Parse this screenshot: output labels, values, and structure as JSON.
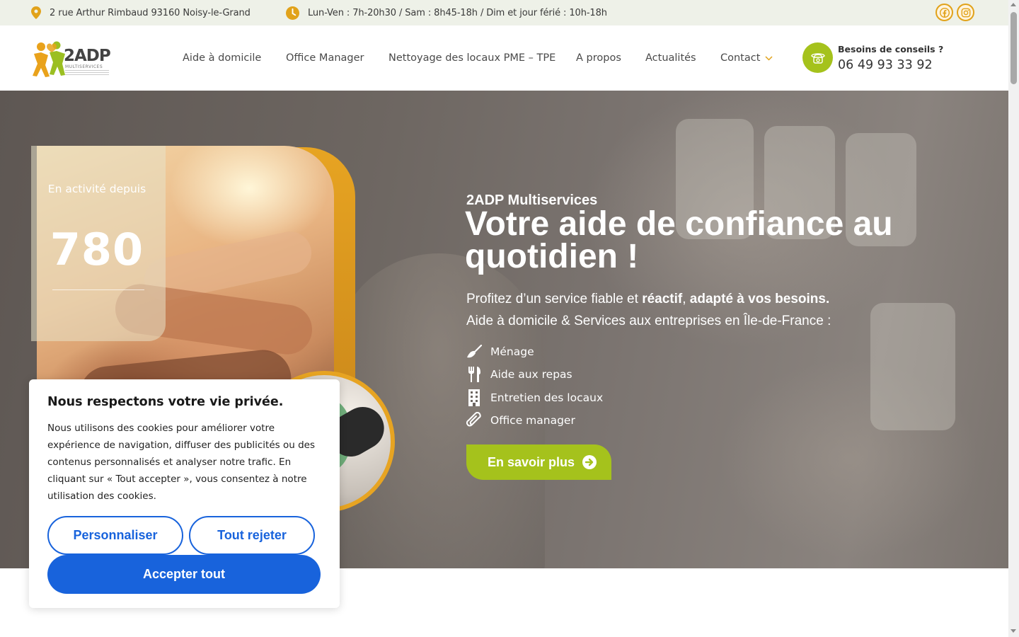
{
  "topbar": {
    "address": "2 rue Arthur Rimbaud 93160 Noisy-le-Grand",
    "address_icon": "map-pin-icon",
    "hours": "Lun-Ven : 7h-20h30 / Sam : 8h45-18h / Dim et jour férié : 10h-18h",
    "hours_icon": "clock-icon",
    "social": [
      "facebook-icon",
      "instagram-icon"
    ],
    "accent_color": "#e1a21a"
  },
  "header": {
    "logo_text": "2ADP",
    "logo_sub": "MULTISERVICES",
    "nav": [
      {
        "label": "Aide à domicile"
      },
      {
        "label": "Office Manager"
      },
      {
        "label": "Nettoyage des locaux PME – TPE"
      },
      {
        "label": "A propos"
      },
      {
        "label": "Actualités"
      },
      {
        "label": "Contact",
        "has_dropdown": true
      }
    ],
    "phone_label": "Besoins de conseils ?",
    "phone_number": "06 49 93 33 92",
    "brand_green": "#a5c21c"
  },
  "hero": {
    "stat_label": "En activité depuis",
    "stat_number": "780",
    "eyebrow": "2ADP Multiservices",
    "title": "Votre aide de confiance au quotidien !",
    "p1_start": "Profitez d’un service fiable et ",
    "p1_bold1": "réactif",
    "p1_mid": ", ",
    "p1_bold2": "adapté à vos besoins.",
    "p2": "Aide à domicile & Services aux entreprises en Île-de-France :",
    "features": [
      {
        "label": "Ménage",
        "icon": "broom-icon"
      },
      {
        "label": "Aide aux repas",
        "icon": "utensils-icon"
      },
      {
        "label": "Entretien des locaux",
        "icon": "building-icon"
      },
      {
        "label": "Office manager",
        "icon": "paperclip-icon"
      }
    ],
    "cta_label": "En savoir plus",
    "cta_icon": "arrow-circle-right-icon"
  },
  "cookie": {
    "title": "Nous respectons votre vie privée.",
    "text": "Nous utilisons des cookies pour améliorer votre expérience de navigation, diffuser des publicités ou des contenus personnalisés et analyser notre trafic. En cliquant sur « Tout accepter », vous consentez à notre utilisation des cookies.",
    "customize_label": "Personnaliser",
    "reject_label": "Tout rejeter",
    "accept_label": "Accepter tout",
    "button_color": "#1863dc"
  }
}
